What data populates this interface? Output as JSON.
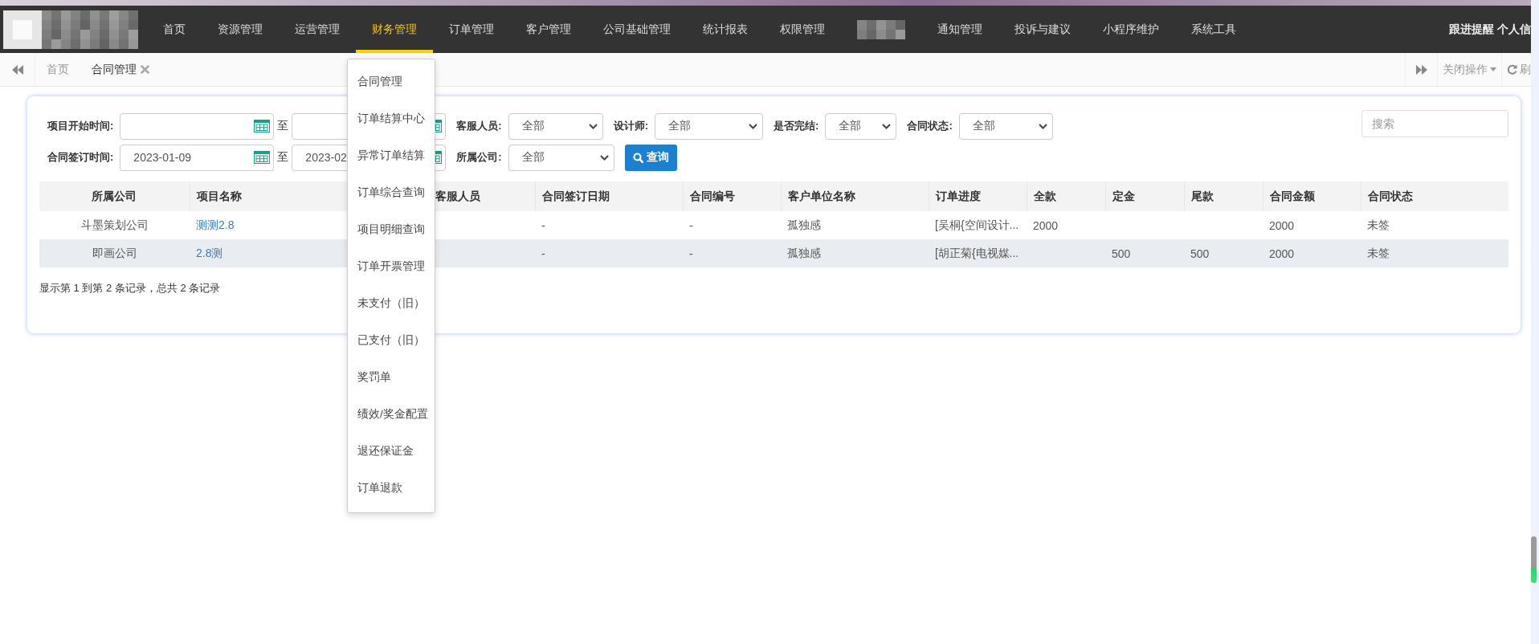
{
  "logo": {
    "kind": "pixelated"
  },
  "top_nav": {
    "items": [
      {
        "kind": "text",
        "label": "首页",
        "selected": false
      },
      {
        "kind": "text",
        "label": "资源管理",
        "selected": false
      },
      {
        "kind": "text",
        "label": "运营管理",
        "selected": false
      },
      {
        "kind": "text",
        "label": "财务管理",
        "selected": true
      },
      {
        "kind": "text",
        "label": "订单管理",
        "selected": false
      },
      {
        "kind": "text",
        "label": "客户管理",
        "selected": false
      },
      {
        "kind": "text",
        "label": "公司基础管理",
        "selected": false
      },
      {
        "kind": "text",
        "label": "统计报表",
        "selected": false
      },
      {
        "kind": "text",
        "label": "权限管理",
        "selected": false
      },
      {
        "kind": "pixelated"
      },
      {
        "kind": "text",
        "label": "通知管理",
        "selected": false
      },
      {
        "kind": "text",
        "label": "投诉与建议",
        "selected": false
      },
      {
        "kind": "text",
        "label": "小程序维护",
        "selected": false
      },
      {
        "kind": "text",
        "label": "系统工具",
        "selected": false
      }
    ],
    "right_links": [
      "跟进提醒",
      "个人信"
    ]
  },
  "tab_bar": {
    "tabs": [
      {
        "label": "首页",
        "selected": false,
        "closable": false
      },
      {
        "label": "合同管理",
        "selected": true,
        "closable": true
      }
    ],
    "close_menu": "关闭操作",
    "refresh": "刷"
  },
  "filter_rows": [
    [
      {
        "kind": "date_range",
        "label": "项目开始时间:",
        "separator": "至"
      },
      {
        "kind": "select",
        "label": "客服人员:",
        "value": "全部"
      },
      {
        "kind": "select",
        "label": "设计师:",
        "value": "全部"
      },
      {
        "kind": "select",
        "label": "是否完结:",
        "value": "全部"
      },
      {
        "kind": "select",
        "label": "合同状态:",
        "value": "全部"
      },
      {
        "kind": "search",
        "placeholder": "搜索"
      }
    ],
    [
      {
        "kind": "date_range",
        "label": "合同签订时间:",
        "start": "2023-01-09",
        "end": "2023-02",
        "separator": "至"
      },
      {
        "kind": "select",
        "label": "所属公司:",
        "value": "全部"
      },
      {
        "kind": "button",
        "label": "查询"
      }
    ]
  ],
  "table": {
    "columns": [
      "所属公司",
      "项目名称",
      "客服人员",
      "合同签订日期",
      "合同编号",
      "客户单位名称",
      "订单进度",
      "全款",
      "定金",
      "尾款",
      "合同金额",
      "合同状态"
    ],
    "rows": [
      [
        "斗墨策划公司",
        {
          "kind": "link",
          "text": "测测2.8"
        },
        null,
        "-",
        "-",
        "孤独感",
        "[吴桐{空间设计...",
        "2000",
        null,
        null,
        "2000",
        "未签"
      ],
      [
        "即画公司",
        {
          "kind": "link",
          "text": "2.8测"
        },
        null,
        "-",
        "-",
        "孤独感",
        "[胡正菊{电视媒...",
        null,
        "500",
        "500",
        "2000",
        "未签"
      ]
    ]
  },
  "pagination_info": "显示第 1 到第 2 条记录，总共 2 条记录",
  "dropdown_menu": {
    "items": [
      "合同管理",
      "订单结算中心",
      "异常订单结算",
      "订单综合查询",
      "项目明细查询",
      "订单开票管理",
      "未支付（旧）",
      "已支付（旧）",
      "奖罚单",
      "绩效/奖金配置",
      "退还保证金",
      "订单退款"
    ]
  }
}
